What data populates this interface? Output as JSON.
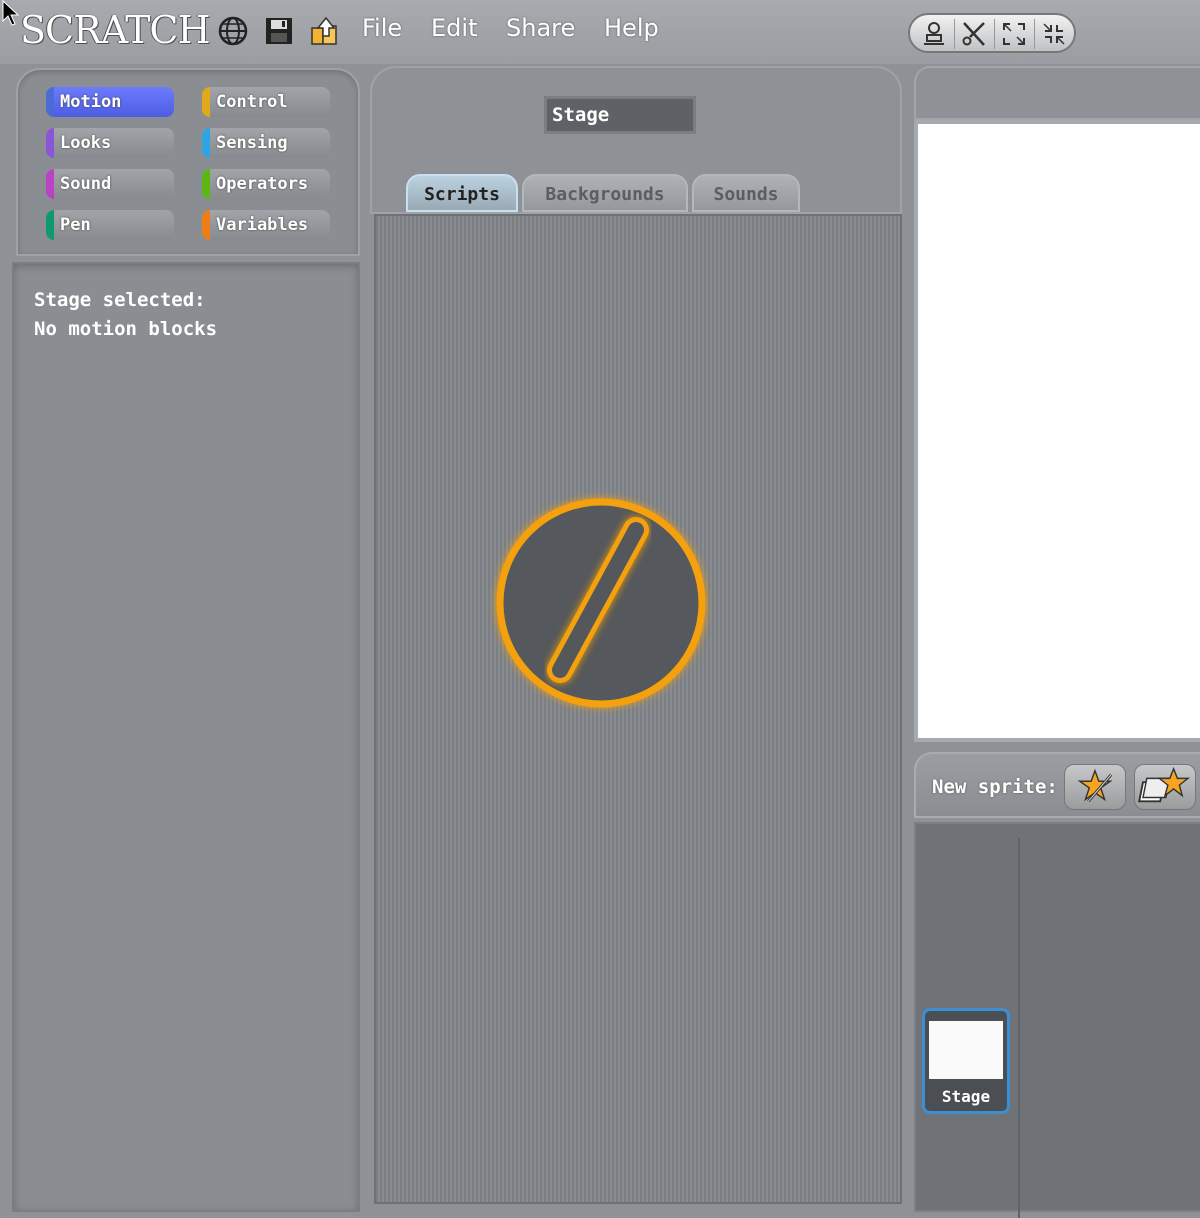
{
  "app": {
    "logo_text": "SCRATCH"
  },
  "menu": {
    "file": "File",
    "edit": "Edit",
    "share": "Share",
    "help": "Help"
  },
  "toolbar_icons": [
    "globe-icon",
    "save-icon",
    "share-upload-icon"
  ],
  "view_modes": [
    "person-stamp-icon",
    "scissors-icon",
    "grow-icon",
    "shrink-icon"
  ],
  "categories": [
    {
      "label": "Motion",
      "color": "#4a6cd4",
      "active": true
    },
    {
      "label": "Control",
      "color": "#e1a91a"
    },
    {
      "label": "Looks",
      "color": "#8a55d7"
    },
    {
      "label": "Sensing",
      "color": "#2ca5e2"
    },
    {
      "label": "Sound",
      "color": "#bb42c3"
    },
    {
      "label": "Operators",
      "color": "#5cb712"
    },
    {
      "label": "Pen",
      "color": "#0e9a6c"
    },
    {
      "label": "Variables",
      "color": "#ee7d16"
    }
  ],
  "palette": {
    "line1": "Stage selected:",
    "line2": "No motion blocks"
  },
  "sprite_name": "Stage",
  "tabs": {
    "scripts": "Scripts",
    "backgrounds": "Backgrounds",
    "sounds": "Sounds"
  },
  "new_sprite": {
    "label": "New sprite:"
  },
  "sprite_list": {
    "stage_label": "Stage"
  },
  "colors": {
    "accent_orange": "#f5a00f",
    "tab_active": "#bcd2e0",
    "selection_blue": "#3d8fd1"
  }
}
